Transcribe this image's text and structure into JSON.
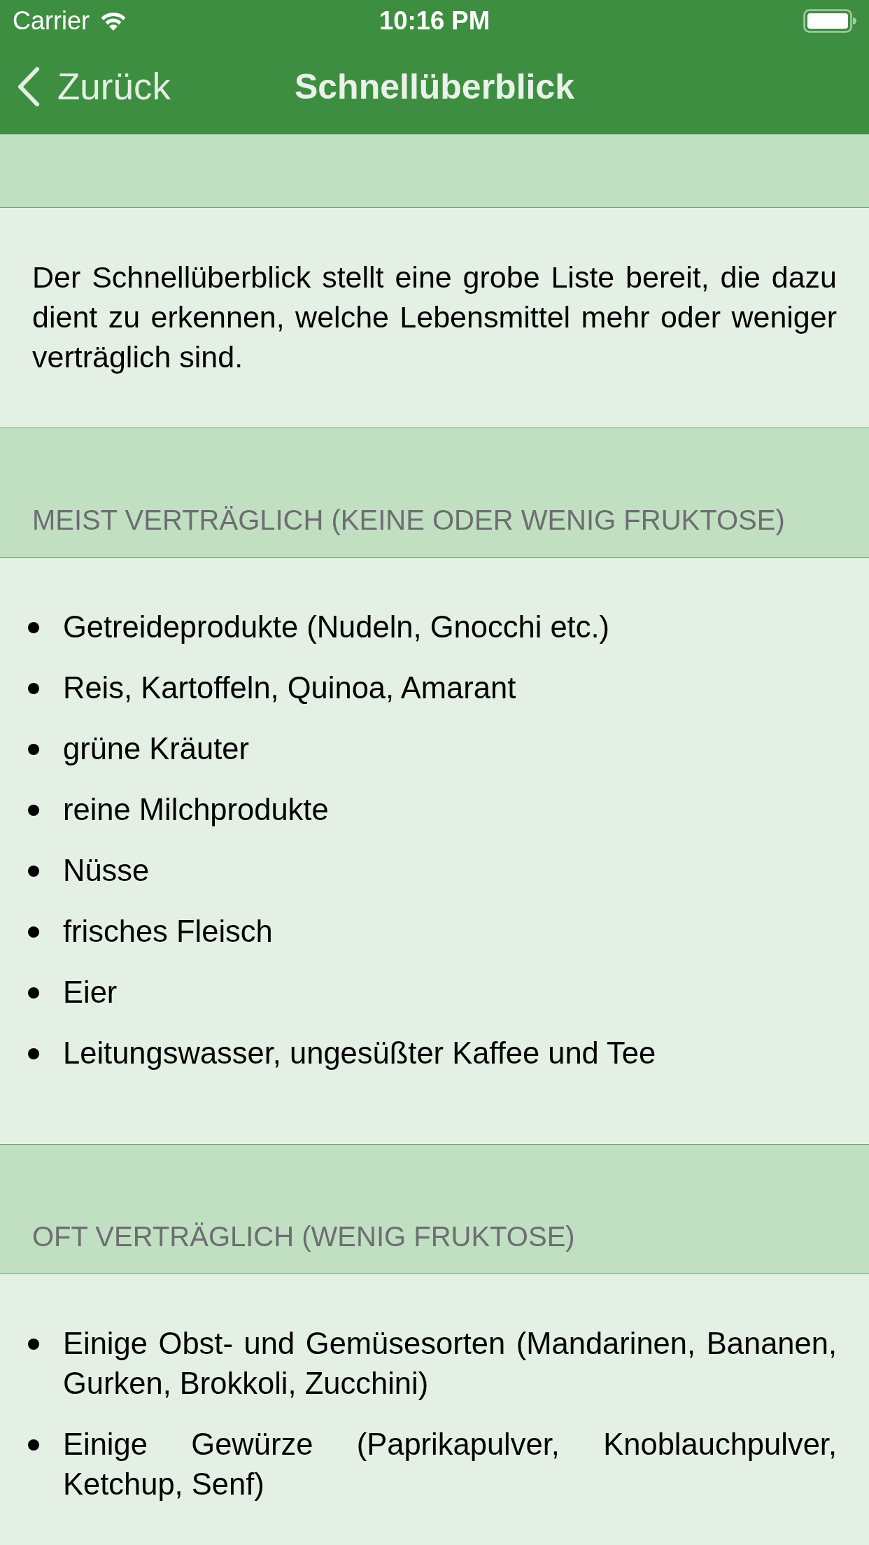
{
  "status_bar": {
    "carrier": "Carrier",
    "time": "10:16 PM"
  },
  "nav_bar": {
    "back_label": "Zurück",
    "title": "Schnellüberblick"
  },
  "intro": {
    "text": "Der Schnellüberblick stellt eine grobe Liste bereit, die dazu dient zu erkennen, welche Lebensmittel mehr oder weniger verträglich sind."
  },
  "sections": [
    {
      "title": "MEIST VERTRÄGLICH (KEINE ODER WENIG FRUKTOSE)",
      "items": [
        "Getreideprodukte (Nudeln, Gnocchi etc.)",
        "Reis, Kartoffeln, Quinoa, Amarant",
        "grüne Kräuter",
        "reine Milchprodukte",
        "Nüsse",
        "frisches Fleisch",
        "Eier",
        "Leitungswasser, ungesüßter Kaffee und Tee"
      ]
    },
    {
      "title": "OFT VERTRÄGLICH (WENIG FRUKTOSE)",
      "items": [
        "Einige Obst- und Gemüsesorten (Mandarinen, Bananen, Gurken, Brokkoli, Zucchini)",
        "Einige Gewürze (Paprikapulver, Knoblauchpulver, Ketchup, Senf)"
      ]
    }
  ]
}
